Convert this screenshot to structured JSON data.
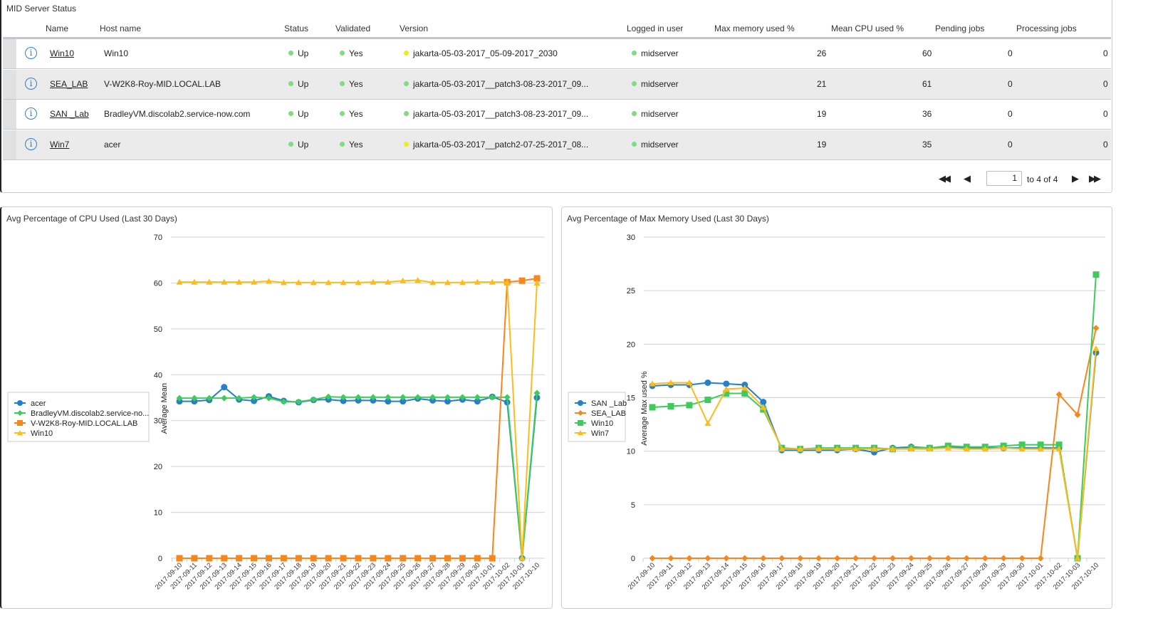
{
  "status_panel": {
    "title": "MID Server Status",
    "columns": [
      "Name",
      "Host name",
      "Status",
      "Validated",
      "Version",
      "Logged in user",
      "Max memory used %",
      "Mean CPU used %",
      "Pending jobs",
      "Processing jobs"
    ],
    "rows": [
      {
        "name": "Win10",
        "host": "Win10",
        "status": "Up",
        "validated": "Yes",
        "version": "jakarta-05-03-2017_05-09-2017_2030",
        "version_color": "#f3ea1c",
        "user": "midserver",
        "max_mem": "26",
        "mean_cpu": "60",
        "pending": "0",
        "processing": "0"
      },
      {
        "name": "SEA_LAB",
        "host": "V-W2K8-Roy-MID.LOCAL.LAB",
        "status": "Up",
        "validated": "Yes",
        "version": "jakarta-05-03-2017__patch3-08-23-2017_09...",
        "version_color": "#7fdc7f",
        "user": "midserver",
        "max_mem": "21",
        "mean_cpu": "61",
        "pending": "0",
        "processing": "0"
      },
      {
        "name": "SAN _Lab",
        "host": "BradleyVM.discolab2.service-now.com",
        "status": "Up",
        "validated": "Yes",
        "version": "jakarta-05-03-2017__patch3-08-23-2017_09...",
        "version_color": "#7fdc7f",
        "user": "midserver",
        "max_mem": "19",
        "mean_cpu": "36",
        "pending": "0",
        "processing": "0"
      },
      {
        "name": "Win7",
        "host": "acer",
        "status": "Up",
        "validated": "Yes",
        "version": "jakarta-05-03-2017__patch2-07-25-2017_08...",
        "version_color": "#f3ea1c",
        "user": "midserver",
        "max_mem": "19",
        "mean_cpu": "35",
        "pending": "0",
        "processing": "0"
      }
    ],
    "status_color": "#7fdc7f",
    "pagination": {
      "page": "1",
      "range_text": "to 4 of 4"
    }
  },
  "chart_data": [
    {
      "type": "line",
      "title": "Avg Percentage of CPU Used (Last 30 Days)",
      "xlabel": "",
      "ylabel": "Average Mean",
      "ylim": [
        0,
        70
      ],
      "yticks": [
        0,
        10,
        20,
        30,
        40,
        50,
        60,
        70
      ],
      "grid": true,
      "legend": "left",
      "categories": [
        "2017-09-10",
        "2017-09-11",
        "2017-09-12",
        "2017-09-13",
        "2017-09-14",
        "2017-09-15",
        "2017-09-16",
        "2017-09-17",
        "2017-09-18",
        "2017-09-19",
        "2017-09-20",
        "2017-09-21",
        "2017-09-22",
        "2017-09-23",
        "2017-09-24",
        "2017-09-25",
        "2017-09-26",
        "2017-09-27",
        "2017-09-28",
        "2017-09-29",
        "2017-09-30",
        "2017-10-01",
        "2017-10-02",
        "2017-10-03",
        "2017-10-10"
      ],
      "series": [
        {
          "name": "acer",
          "color": "#2480c8",
          "marker": "circle",
          "values": [
            34.2,
            34.2,
            34.5,
            37.3,
            34.6,
            34.3,
            35.3,
            34.3,
            34.0,
            34.5,
            34.6,
            34.3,
            34.4,
            34.4,
            34.2,
            34.2,
            34.8,
            34.4,
            34.2,
            34.6,
            34.2,
            35.2,
            34.0,
            0,
            35.0
          ]
        },
        {
          "name": "BradleyVM.discolab2.service-no...",
          "color": "#3fcb5b",
          "marker": "diamond",
          "values": [
            34.9,
            34.9,
            34.9,
            34.9,
            34.9,
            35.1,
            34.9,
            34.1,
            34.1,
            34.6,
            35.2,
            35.1,
            35.1,
            35.1,
            35.1,
            35.1,
            35.1,
            35.1,
            35.1,
            35.1,
            35.1,
            35.1,
            35.1,
            0,
            36.0
          ]
        },
        {
          "name": "V-W2K8-Roy-MID.LOCAL.LAB",
          "color": "#f7861c",
          "marker": "square",
          "values": [
            0,
            0,
            0,
            0,
            0,
            0,
            0,
            0,
            0,
            0,
            0,
            0,
            0,
            0,
            0,
            0,
            0,
            0,
            0,
            0,
            0,
            0,
            60.2,
            60.5,
            61.0
          ]
        },
        {
          "name": "Win10",
          "color": "#fbbd1c",
          "marker": "triangle",
          "values": [
            60.2,
            60.2,
            60.2,
            60.2,
            60.2,
            60.2,
            60.4,
            60.1,
            60.1,
            60.1,
            60.1,
            60.1,
            60.1,
            60.2,
            60.2,
            60.5,
            60.6,
            60.1,
            60.1,
            60.1,
            60.2,
            60.2,
            60.2,
            0,
            60.0
          ]
        }
      ]
    },
    {
      "type": "line",
      "title": "Avg Percentage of Max Memory Used (Last 30 Days)",
      "xlabel": "",
      "ylabel": "Average Max used %",
      "ylim": [
        0,
        30
      ],
      "yticks": [
        0,
        5,
        10,
        15,
        20,
        25,
        30
      ],
      "grid": true,
      "legend": "left",
      "categories": [
        "2017-09-10",
        "2017-09-11",
        "2017-09-12",
        "2017-09-13",
        "2017-09-14",
        "2017-09-15",
        "2017-09-16",
        "2017-09-17",
        "2017-09-18",
        "2017-09-19",
        "2017-09-20",
        "2017-09-21",
        "2017-09-22",
        "2017-09-23",
        "2017-09-24",
        "2017-09-25",
        "2017-09-26",
        "2017-09-27",
        "2017-09-28",
        "2017-09-29",
        "2017-09-30",
        "2017-10-01",
        "2017-10-02",
        "2017-10-03",
        "2017-10-10"
      ],
      "series": [
        {
          "name": "SAN _Lab",
          "color": "#2480c8",
          "marker": "circle",
          "values": [
            16.1,
            16.2,
            16.2,
            16.4,
            16.3,
            16.2,
            14.6,
            10.1,
            10.1,
            10.1,
            10.1,
            10.2,
            9.9,
            10.3,
            10.4,
            10.3,
            10.4,
            10.3,
            10.3,
            10.3,
            10.3,
            10.3,
            10.3,
            0,
            19.2
          ]
        },
        {
          "name": "SEA_LAB",
          "color": "#f7861c",
          "marker": "diamond",
          "values": [
            0,
            0,
            0,
            0,
            0,
            0,
            0,
            0,
            0,
            0,
            0,
            0,
            0,
            0,
            0,
            0,
            0,
            0,
            0,
            0,
            0,
            0,
            15.3,
            13.4,
            21.5
          ]
        },
        {
          "name": "Win10",
          "color": "#3fcb5b",
          "marker": "square",
          "values": [
            14.1,
            14.2,
            14.3,
            14.8,
            15.4,
            15.4,
            13.9,
            10.3,
            10.2,
            10.3,
            10.3,
            10.3,
            10.3,
            10.2,
            10.3,
            10.3,
            10.5,
            10.4,
            10.4,
            10.5,
            10.6,
            10.6,
            10.6,
            0,
            26.5
          ]
        },
        {
          "name": "Win7",
          "color": "#fbbd1c",
          "marker": "triangle",
          "values": [
            16.3,
            16.4,
            16.4,
            12.6,
            15.8,
            15.9,
            14.1,
            10.2,
            10.2,
            10.2,
            10.2,
            10.2,
            10.2,
            10.2,
            10.2,
            10.2,
            10.3,
            10.2,
            10.2,
            10.3,
            10.2,
            10.2,
            10.2,
            0,
            19.6
          ]
        }
      ]
    }
  ]
}
